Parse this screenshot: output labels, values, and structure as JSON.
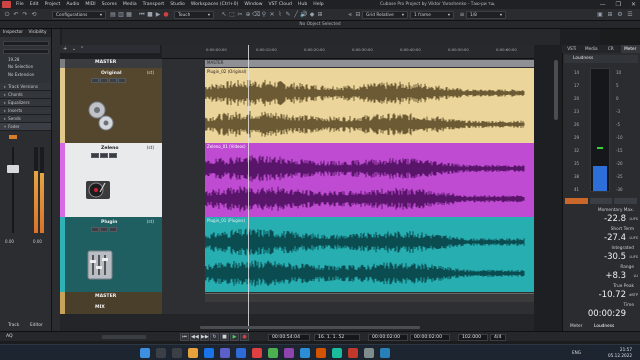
{
  "window": {
    "title": "Cubase Pro Project by Viktor Yaroshenko - Таю-ри тщ",
    "menu": [
      "File",
      "Edit",
      "Project",
      "Audio",
      "MIDI",
      "Scores",
      "Media",
      "Transport",
      "Studio",
      "Workspaces (Ctrl+0)",
      "Window",
      "VST Cloud",
      "Hub",
      "Help"
    ],
    "controls": [
      "—",
      "❐",
      "✕"
    ]
  },
  "toolbar": {
    "configurations": "Configurations",
    "touch": "Touch",
    "grid": "Grid Relative",
    "quantize_frame": "1 frame",
    "quantize": "1/8"
  },
  "status": {
    "text": "No Object Selected"
  },
  "inspector": {
    "tabs": [
      "Inspector",
      "Visibility"
    ],
    "fields": [
      "19.28",
      "No Selection",
      "No Extension"
    ],
    "sections": [
      "Track Versions",
      "Chords",
      "Equalizers",
      "Inserts",
      "Sends",
      "Fader"
    ],
    "fader_value": "0.00",
    "fader_right": "0.00",
    "bottom_tabs": [
      "Track",
      "Editor"
    ]
  },
  "ruler": {
    "marks": [
      "0:00:00:00",
      "0:00:10:00",
      "0:00:20:00",
      "0:00:30:00",
      "0:00:40:00",
      "0:00:50:00",
      "0:00:60:00"
    ],
    "master_label": "MASTER"
  },
  "tracks": [
    {
      "name": "MASTER",
      "inst": "",
      "color": "#7b7d80"
    },
    {
      "name": "Original",
      "inst": "(st)",
      "color": "#e0c98a",
      "clip": "Plugin_02 (Original)",
      "clip_color": "#ecd59a",
      "wave": "#6b5a33"
    },
    {
      "name": "Zeleno",
      "inst": "(st)",
      "color": "#d86ae6",
      "clip": "Zeleno_01 (Videos)",
      "clip_color": "#c04bd3",
      "wave": "#58156a"
    },
    {
      "name": "Plugin",
      "inst": "(st)",
      "color": "#2fb2b5",
      "clip": "Plugin_01 (Plugins)",
      "clip_color": "#26aeb1",
      "wave": "#0b4c51"
    },
    {
      "name": "MASTER",
      "inst": "",
      "color": "#c7a25a"
    },
    {
      "name": "MIX",
      "inst": "",
      "color": "#c7a25a"
    }
  ],
  "right_panel": {
    "tabs": [
      "VSTi",
      "Media",
      "CR",
      "Meter"
    ],
    "header": "Loudness",
    "scale": [
      "14",
      "17",
      "20",
      "23",
      "26",
      "29",
      "32",
      "35",
      "38",
      "41"
    ],
    "scale_right": [
      "10",
      "5",
      "0",
      "-3",
      "-5",
      "-10",
      "-15",
      "-20",
      "-25",
      "-30"
    ],
    "meters": [
      {
        "label": "Momentary Max.",
        "value": "-22.8"
      },
      {
        "label": "Short Term",
        "value": "-27.4"
      },
      {
        "label": "Integrated",
        "value": "-30.5"
      },
      {
        "label": "Range",
        "value": "+8.3"
      },
      {
        "label": "True Peak",
        "value": "-10.72"
      },
      {
        "label": "Time",
        "value": "00:00:29"
      }
    ],
    "lufs": [
      "LUFS",
      "LUFS",
      "LUFS",
      "LU",
      "dBTP"
    ],
    "bottom_tabs": [
      "Meter",
      "Loudness"
    ],
    "meter_fill": 0.2
  },
  "transport": {
    "position": "00:00:54:04",
    "bars": "16. 1. 1. 52",
    "left_locator": "00:00:02:00",
    "right_locator": "00:00:02:00",
    "tempo": "102.000",
    "signature": "4/4",
    "aq": "AQ"
  },
  "taskbar": {
    "lang": "ENG",
    "time": "21:57",
    "date": "05.12.2022"
  }
}
